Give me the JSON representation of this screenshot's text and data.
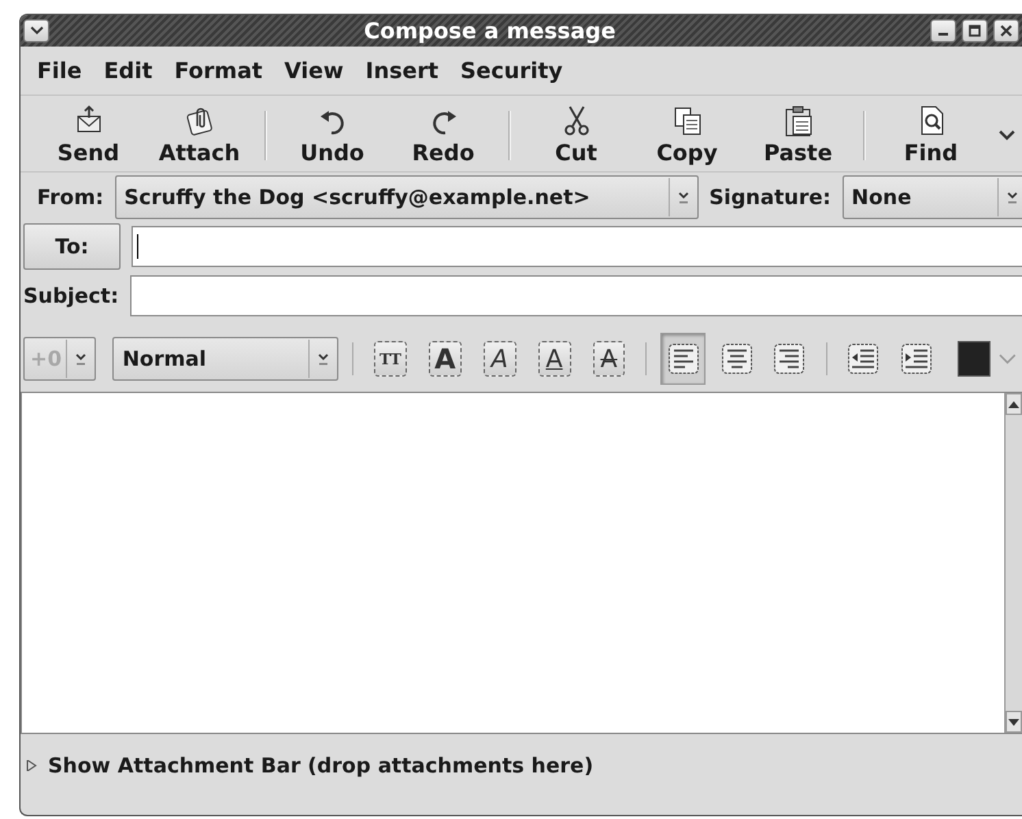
{
  "window": {
    "title": "Compose a message"
  },
  "menu": [
    {
      "label": "File"
    },
    {
      "label": "Edit"
    },
    {
      "label": "Format"
    },
    {
      "label": "View"
    },
    {
      "label": "Insert"
    },
    {
      "label": "Security"
    }
  ],
  "toolbar": {
    "groups": [
      [
        {
          "label": "Send"
        },
        {
          "label": "Attach"
        }
      ],
      [
        {
          "label": "Undo"
        },
        {
          "label": "Redo"
        }
      ],
      [
        {
          "label": "Cut"
        },
        {
          "label": "Copy"
        },
        {
          "label": "Paste"
        }
      ],
      [
        {
          "label": "Find"
        }
      ]
    ]
  },
  "from": {
    "label": "From:",
    "value": "Scruffy the Dog <scruffy@example.net>"
  },
  "signature": {
    "label": "Signature:",
    "value": "None"
  },
  "to": {
    "label": "To:",
    "focused": true
  },
  "subject": {
    "label": "Subject:",
    "focused": false
  },
  "format_toolbar": {
    "size": {
      "value": "+0",
      "disabled": true
    },
    "paragraph": {
      "value": "Normal"
    },
    "style_buttons": [
      {
        "label": "TT"
      },
      {
        "label": "A"
      },
      {
        "label": "A"
      },
      {
        "label": "A"
      },
      {
        "label": "A"
      }
    ],
    "align_buttons": [
      {
        "selected": true
      },
      {
        "selected": false
      },
      {
        "selected": false
      }
    ]
  },
  "attachment_bar": {
    "label": "Show Attachment Bar (drop attachments here)",
    "expanded": false
  }
}
